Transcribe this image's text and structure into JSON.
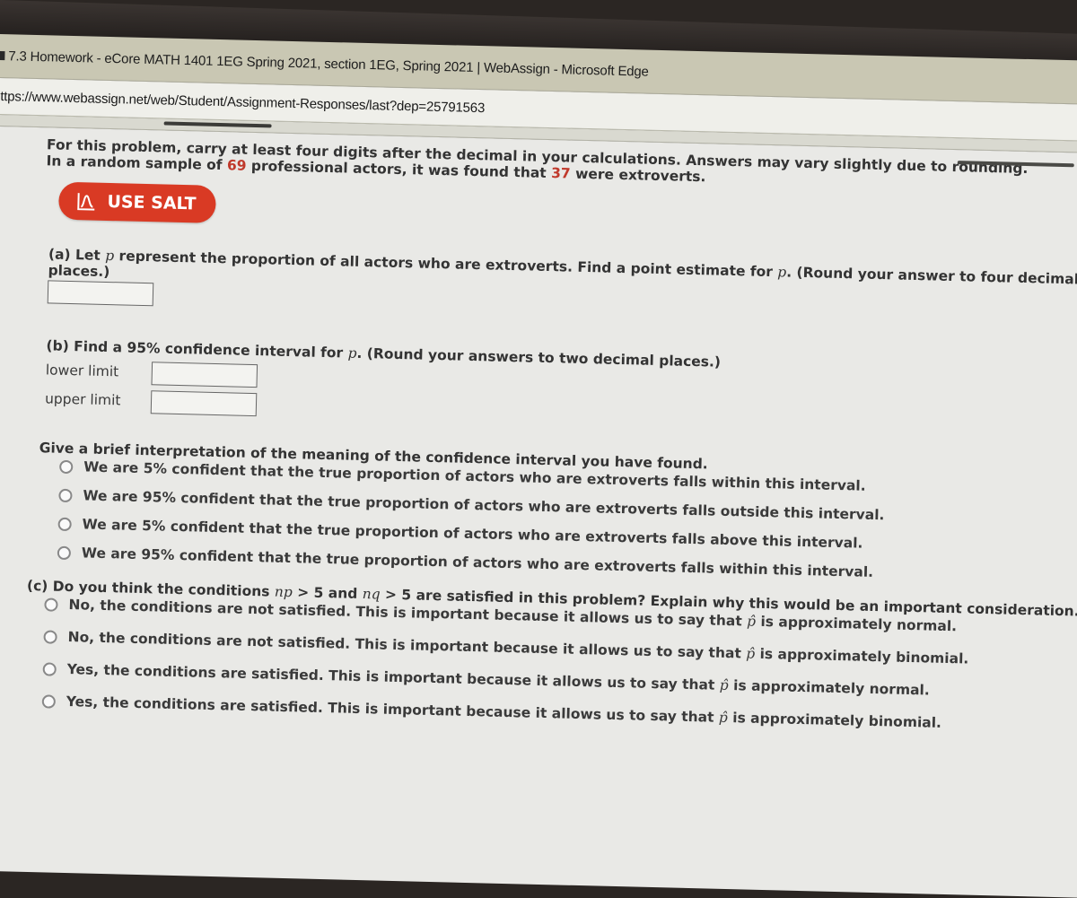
{
  "window": {
    "title": "7.3 Homework - eCore MATH 1401 1EG Spring 2021, section 1EG, Spring 2021 | WebAssign - Microsoft Edge",
    "url": "ttps://www.webassign.net/web/Student/Assignment-Responses/last?dep=25791563"
  },
  "problem": {
    "intro": "For this problem, carry at least four digits after the decimal in your calculations. Answers may vary slightly due to rounding.",
    "sample_prefix": "In a random sample of ",
    "sample_n": "69",
    "sample_mid": " professional actors, it was found that ",
    "sample_x": "37",
    "sample_suffix": " were extroverts.",
    "highlight_color": "#c0392b"
  },
  "salt_button": {
    "label": "USE SALT",
    "icon": "salt-bell-curve-icon",
    "color": "#d93a24"
  },
  "part_a": {
    "prefix": "(a) Let ",
    "var": "p",
    "mid": " represent the proportion of all actors who are extroverts. Find a point estimate for ",
    "var2": "p",
    "suffix": ". (Round your answer to four decimal places.)",
    "answer_value": ""
  },
  "part_b": {
    "prefix": "(b) Find a 95% confidence interval for ",
    "var": "p",
    "suffix": ". (Round your answers to two decimal places.)",
    "lower_label": "lower limit",
    "lower_value": "",
    "upper_label": "upper limit",
    "upper_value": ""
  },
  "interpretation": {
    "question": "Give a brief interpretation of the meaning of the confidence interval you have found.",
    "options": [
      "We are 5% confident that the true proportion of actors who are extroverts falls within this interval.",
      "We are 95% confident that the true proportion of actors who are extroverts falls outside this interval.",
      "We are 5% confident that the true proportion of actors who are extroverts falls above this interval.",
      "We are 95% confident that the true proportion of actors who are extroverts falls within this interval."
    ]
  },
  "part_c": {
    "prefix": "(c) Do you think the conditions ",
    "cond1": "np",
    "cond1_rest": " > 5 and ",
    "cond2": "nq",
    "cond2_rest": " > 5 are satisfied in this problem? Explain why this would be an important consideration.",
    "options": [
      {
        "pre": "No, the conditions are not satisfied. This is important because it allows us to say that ",
        "var": "p̂",
        "post": " is approximately normal."
      },
      {
        "pre": "No, the conditions are not satisfied. This is important because it allows us to say that ",
        "var": "p̂",
        "post": " is approximately binomial."
      },
      {
        "pre": "Yes, the conditions are satisfied. This is important because it allows us to say that ",
        "var": "p̂",
        "post": " is approximately normal."
      },
      {
        "pre": "Yes, the conditions are satisfied. This is important because it allows us to say that ",
        "var": "p̂",
        "post": " is approximately binomial."
      }
    ]
  }
}
